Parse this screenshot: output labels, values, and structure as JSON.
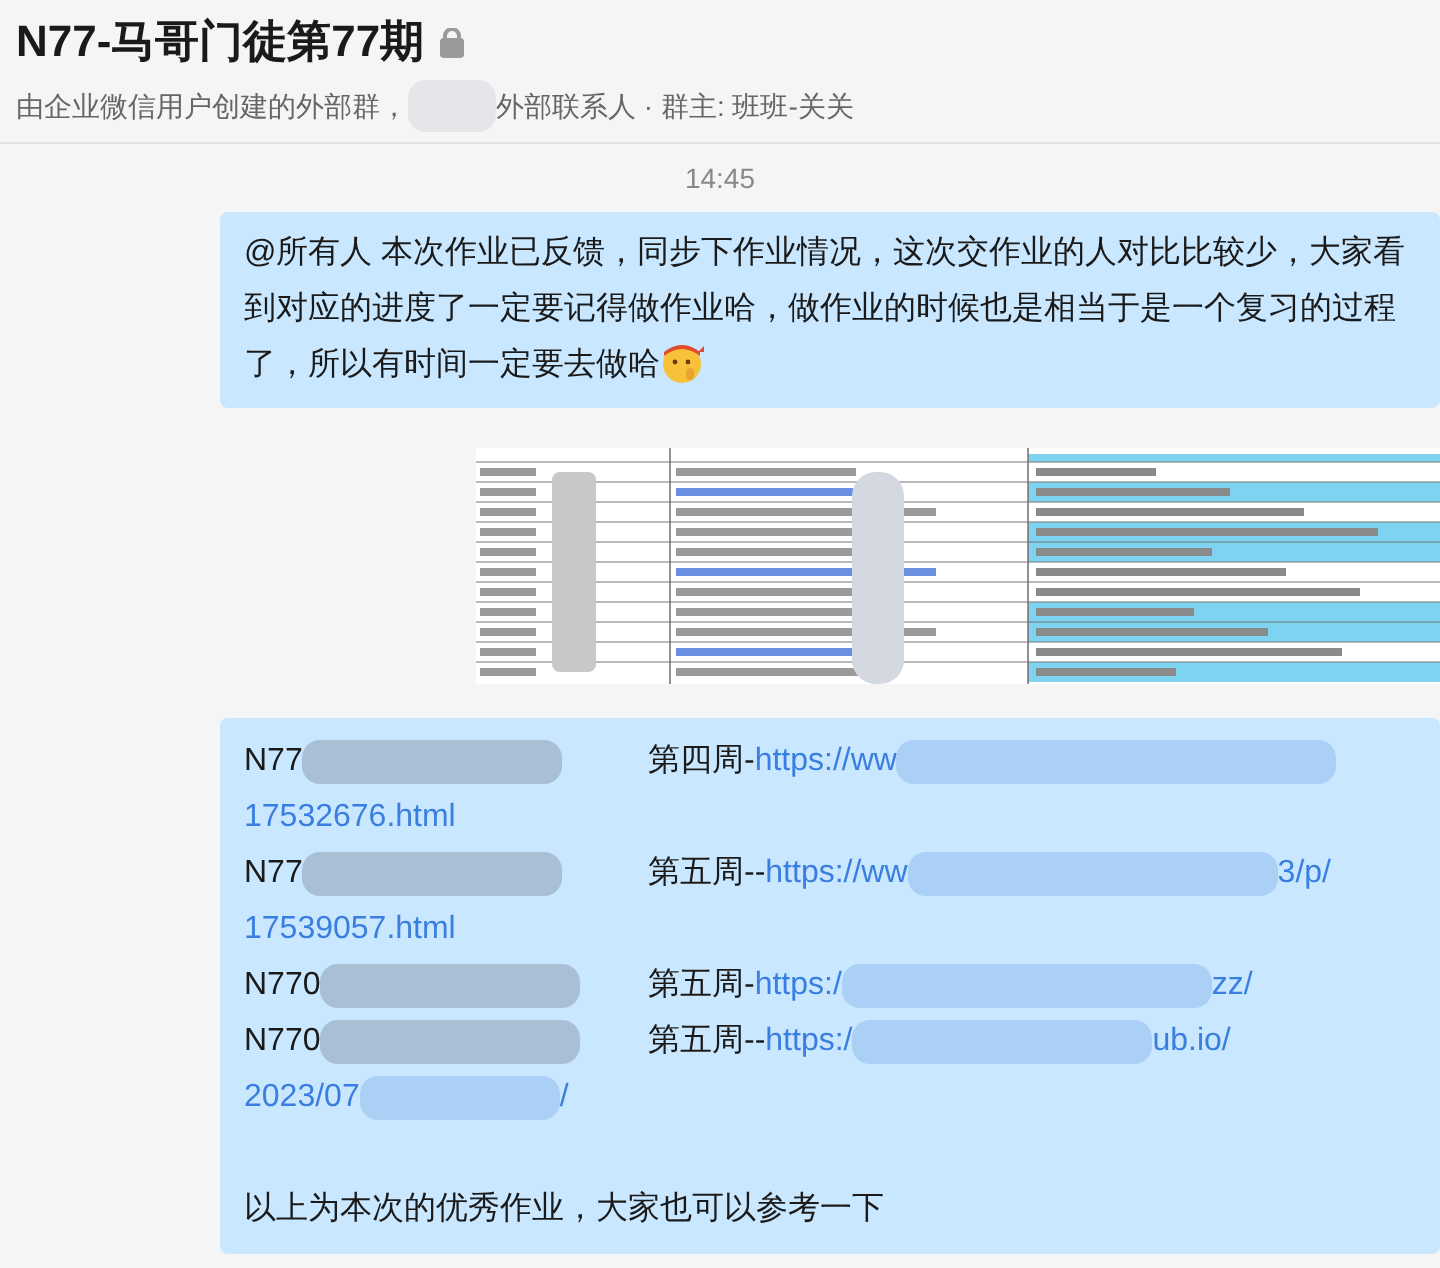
{
  "header": {
    "title": "N77-马哥门徒第77期",
    "locked": true,
    "subtitle_head": "由企业微信用户创建的外部群，",
    "subtitle_tail": "外部联系人 · 群主: 班班-关关"
  },
  "time": "14:45",
  "messages": [
    {
      "kind": "text",
      "text": "@所有人  本次作业已反馈，同步下作业情况，这次交作业的人对比比较少，大家看到对应的进度了一定要记得做作业哈，做作业的时候也是相当于是一个复习的过程了，所以有时间一定要去做哈",
      "trailing_emoji": true
    },
    {
      "kind": "image"
    },
    {
      "kind": "list",
      "rows": [
        {
          "name": "N77",
          "label": "第四周-",
          "link_head": "https://ww",
          "continued": "17532676.html"
        },
        {
          "name": "N77",
          "label": "第五周--",
          "link_head": "https://ww",
          "link_tail": "3/p/",
          "continued": "17539057.html"
        },
        {
          "name": "N770",
          "label": "第五周-",
          "link_head": "https:/",
          "link_tail": "zz/"
        },
        {
          "name": "N770",
          "label": "第五周--",
          "link_head": "https:/",
          "link_tail": "ub.io/",
          "continued": "2023/07",
          "continued_tail": "/"
        }
      ],
      "footer": "以上为本次的优秀作业，大家也可以参考一下"
    }
  ]
}
